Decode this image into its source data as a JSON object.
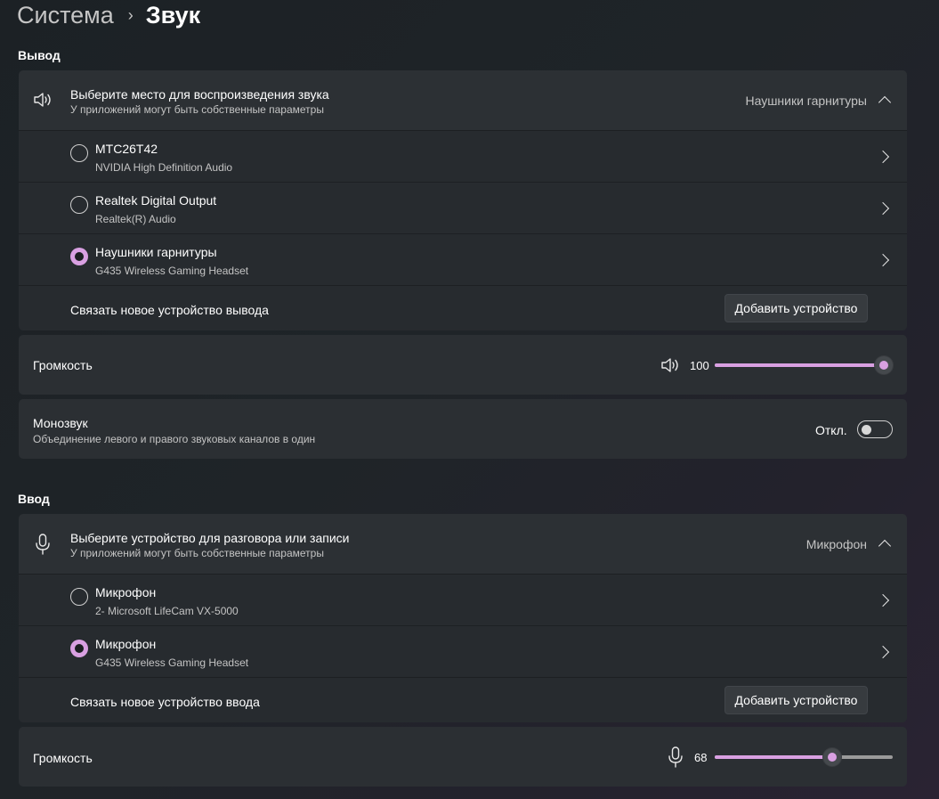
{
  "breadcrumb": {
    "parent": "Система",
    "current": "Звук"
  },
  "output": {
    "section_label": "Вывод",
    "header": {
      "title": "Выберите место для воспроизведения звука",
      "subtitle": "У приложений могут быть собственные параметры",
      "selected": "Наушники гарнитуры",
      "icon": "speaker-icon"
    },
    "devices": [
      {
        "name": "MTC26T42",
        "driver": "NVIDIA High Definition Audio",
        "selected": false
      },
      {
        "name": "Realtek Digital Output",
        "driver": "Realtek(R) Audio",
        "selected": false
      },
      {
        "name": "Наушники гарнитуры",
        "driver": "G435 Wireless Gaming Headset",
        "selected": true
      }
    ],
    "pair_label": "Связать новое устройство вывода",
    "add_button": "Добавить устройство",
    "volume": {
      "label": "Громкость",
      "value": "100",
      "level": 100,
      "icon": "speaker-icon"
    },
    "mono": {
      "title": "Монозвук",
      "subtitle": "Объединение левого и правого звуковых каналов в один",
      "state": "Откл.",
      "on": false
    }
  },
  "input": {
    "section_label": "Ввод",
    "header": {
      "title": "Выберите устройство для разговора или записи",
      "subtitle": "У приложений могут быть собственные параметры",
      "selected": "Микрофон",
      "icon": "microphone-icon"
    },
    "devices": [
      {
        "name": "Микрофон",
        "driver": "2- Microsoft LifeCam VX-5000",
        "selected": false
      },
      {
        "name": "Микрофон",
        "driver": "G435 Wireless Gaming Headset",
        "selected": true
      }
    ],
    "pair_label": "Связать новое устройство ввода",
    "add_button": "Добавить устройство",
    "volume": {
      "label": "Громкость",
      "value": "68",
      "level": 68,
      "icon": "microphone-icon"
    }
  },
  "colors": {
    "accent": "#d9a0e2",
    "card": "#2b2f33",
    "background": "#1f2428"
  }
}
